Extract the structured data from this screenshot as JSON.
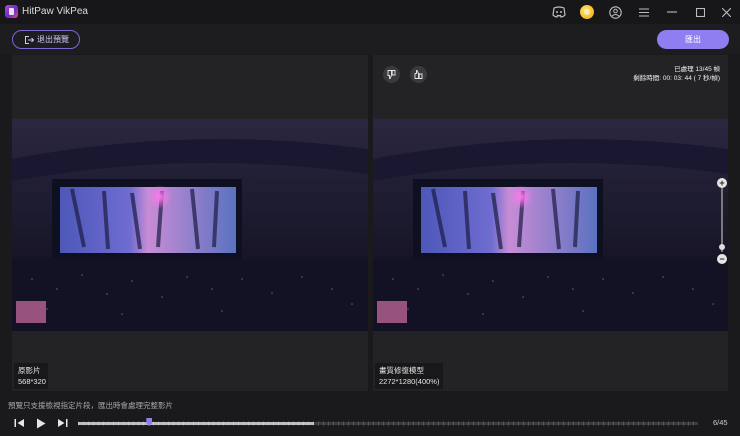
{
  "app": {
    "title": "HitPaw VikPea"
  },
  "toolbar": {
    "exit_label": "退出預覽",
    "export_label": "匯出"
  },
  "left_panel": {
    "label": "原影片",
    "resolution": "568*320"
  },
  "right_panel": {
    "label": "畫質修復模型",
    "resolution": "2272*1280(400%)",
    "status_processed": "已處理 13/45 幀",
    "status_remaining": "剩餘時間: 00: 03: 44 ( 7 秒/幀)"
  },
  "hint": "預覽只支援檢視指定片段，匯出時會處理完整影片",
  "playback": {
    "counter": "6/45",
    "progress": 0.38,
    "marker": 0.115
  },
  "colors": {
    "accent": "#8f7ef2",
    "background": "#1a1a1c"
  },
  "icons": [
    "app-logo-icon",
    "discord-icon",
    "coin-icon",
    "user-icon",
    "menu-icon",
    "minimize-icon",
    "maximize-icon",
    "close-icon",
    "exit-icon",
    "thumbs-down-icon",
    "thumbs-up-icon",
    "zoom-in-icon",
    "zoom-out-icon",
    "step-back-icon",
    "play-icon",
    "step-forward-icon"
  ]
}
